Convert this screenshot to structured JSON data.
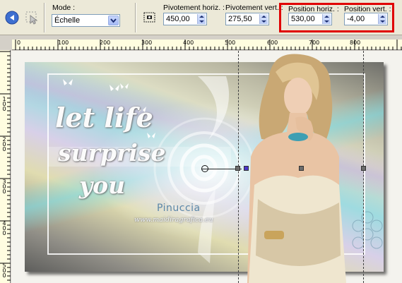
{
  "toolbar": {
    "mode_label": "Mode :",
    "mode_value": "Échelle",
    "pivot_h_label": "Pivotement horiz. :",
    "pivot_h_value": "450,00",
    "pivot_v_label": "Pivotement vert. :",
    "pivot_v_value": "275,50",
    "pos_h_label": "Position horiz. :",
    "pos_h_value": "530,00",
    "pos_v_label": "Position vert. :",
    "pos_v_value": "-4,00"
  },
  "ruler_h": [
    "0",
    "100",
    "200",
    "300",
    "400",
    "500",
    "600",
    "700",
    "800"
  ],
  "ruler_v": [
    "1 0 0",
    "2 0 0",
    "3 0 0",
    "4 0 0",
    "5 0 0"
  ],
  "artwork": {
    "quote_line1": "let life",
    "quote_line2": "surprise",
    "quote_line3": "you",
    "credit_name": "Pinuccia",
    "credit_url": "www.maidiragrafica.eu"
  },
  "colors": {
    "highlight": "#e00000",
    "toolbar_bg": "#ece9d8",
    "ruler_bg": "#fffde0"
  }
}
